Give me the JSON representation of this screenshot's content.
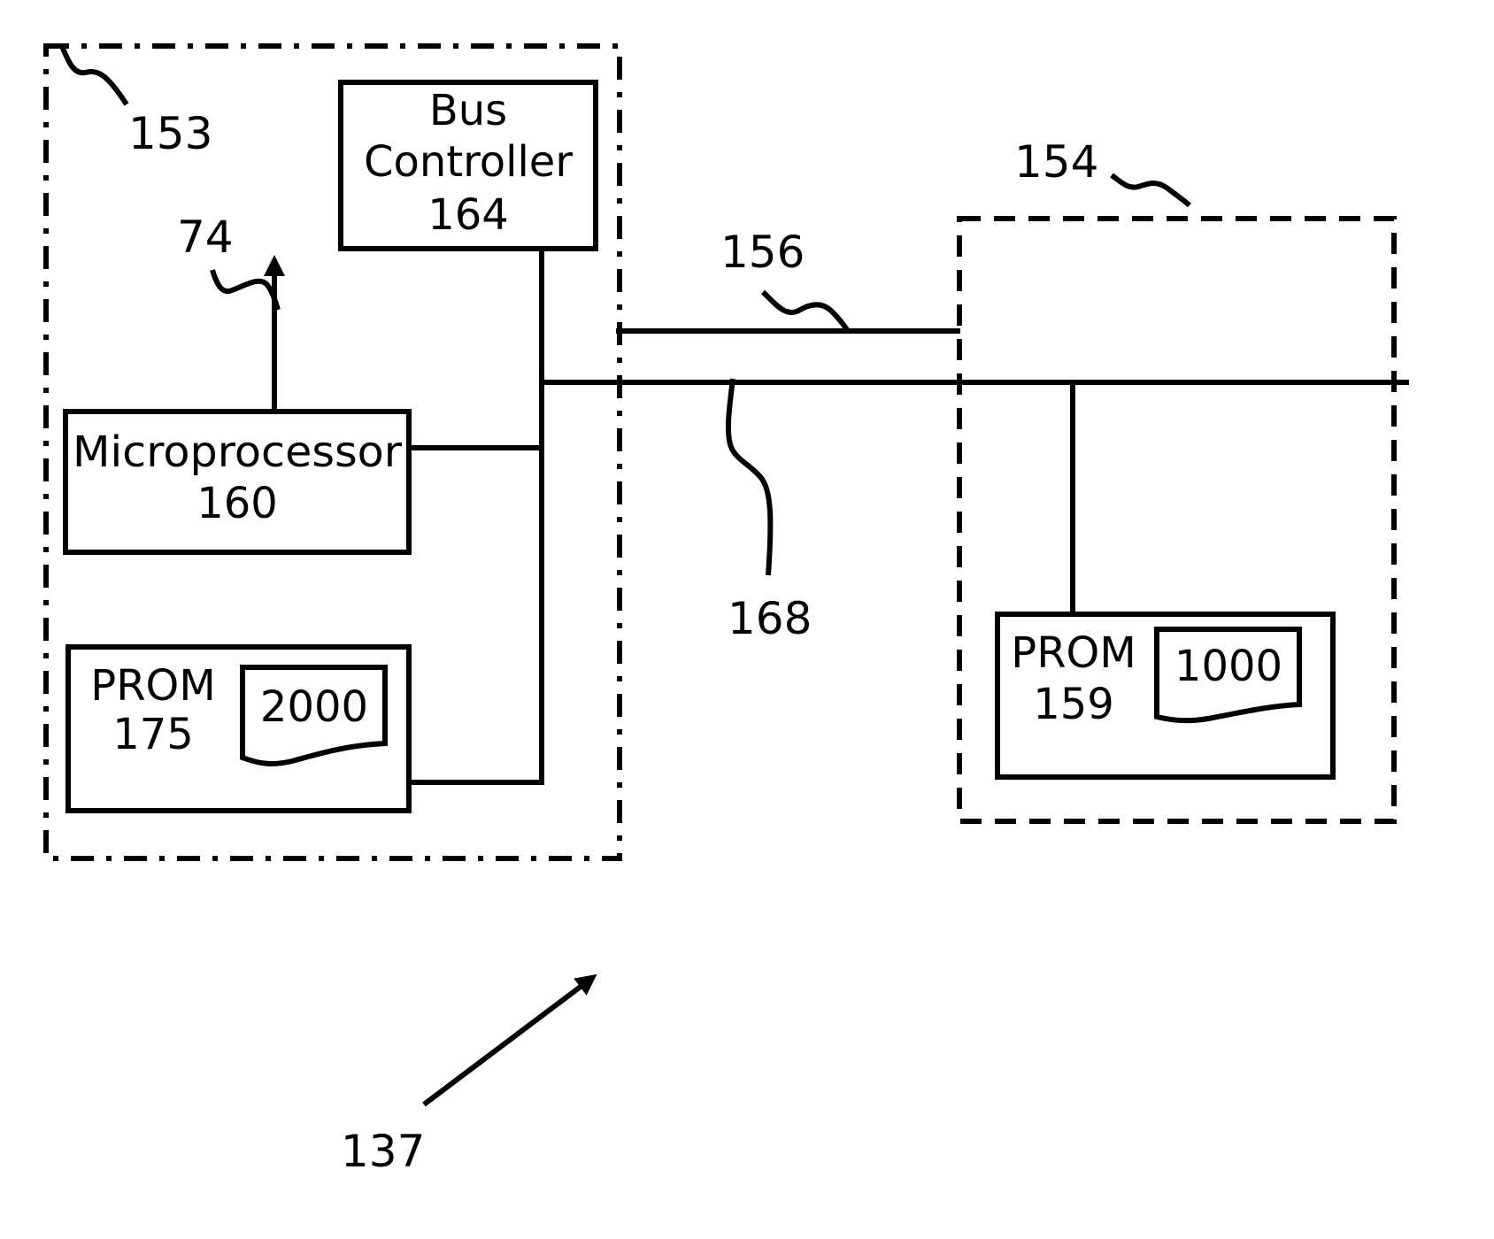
{
  "figure": {
    "type": "block-diagram",
    "colors": {
      "line": "#000000",
      "background": "#ffffff"
    }
  },
  "groups": {
    "module_153": {
      "ref": "153",
      "border": "dash-dot"
    },
    "module_154": {
      "ref": "154",
      "border": "dashed"
    }
  },
  "blocks": {
    "bus_controller": {
      "line1": "Bus",
      "line2": "Controller",
      "ref": "164"
    },
    "microprocessor": {
      "line1": "Microprocessor",
      "ref": "160"
    },
    "prom_175": {
      "line1": "PROM",
      "ref": "175",
      "document": "2000"
    },
    "prom_159": {
      "line1": "PROM",
      "ref": "159",
      "document": "1000"
    }
  },
  "references": {
    "output_74": "74",
    "line_156": "156",
    "bus_168": "168",
    "system_137": "137"
  }
}
